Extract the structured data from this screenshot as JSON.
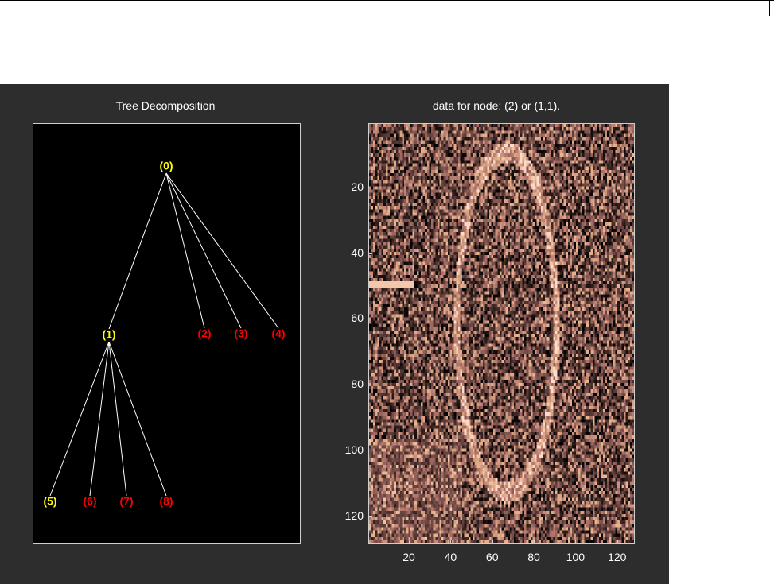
{
  "figure": {
    "left_axes": {
      "title": "Tree Decomposition",
      "nodes": [
        {
          "label": "(0)",
          "color": "#ffff00"
        },
        {
          "label": "(1)",
          "color": "#ffff00"
        },
        {
          "label": "(2)",
          "color": "#ff0000"
        },
        {
          "label": "(3)",
          "color": "#ff0000"
        },
        {
          "label": "(4)",
          "color": "#ff0000"
        },
        {
          "label": "(5)",
          "color": "#ffff00"
        },
        {
          "label": "(6)",
          "color": "#ff0000"
        },
        {
          "label": "(7)",
          "color": "#ff0000"
        },
        {
          "label": "(8)",
          "color": "#ff0000"
        }
      ],
      "edges": [
        [
          "(0)",
          "(1)"
        ],
        [
          "(0)",
          "(2)"
        ],
        [
          "(0)",
          "(3)"
        ],
        [
          "(0)",
          "(4)"
        ],
        [
          "(1)",
          "(5)"
        ],
        [
          "(1)",
          "(6)"
        ],
        [
          "(1)",
          "(7)"
        ],
        [
          "(1)",
          "(8)"
        ]
      ],
      "edge_color": "#ffffff",
      "background": "#000000"
    },
    "right_axes": {
      "title": "data for node: (2) or (1,1).",
      "y_ticks": [
        "20",
        "40",
        "60",
        "80",
        "100",
        "120"
      ],
      "x_ticks": [
        "20",
        "40",
        "60",
        "80",
        "100",
        "120"
      ],
      "colormap": "pink",
      "image_size": [
        128,
        128
      ]
    },
    "background": "#2d2d2d"
  }
}
